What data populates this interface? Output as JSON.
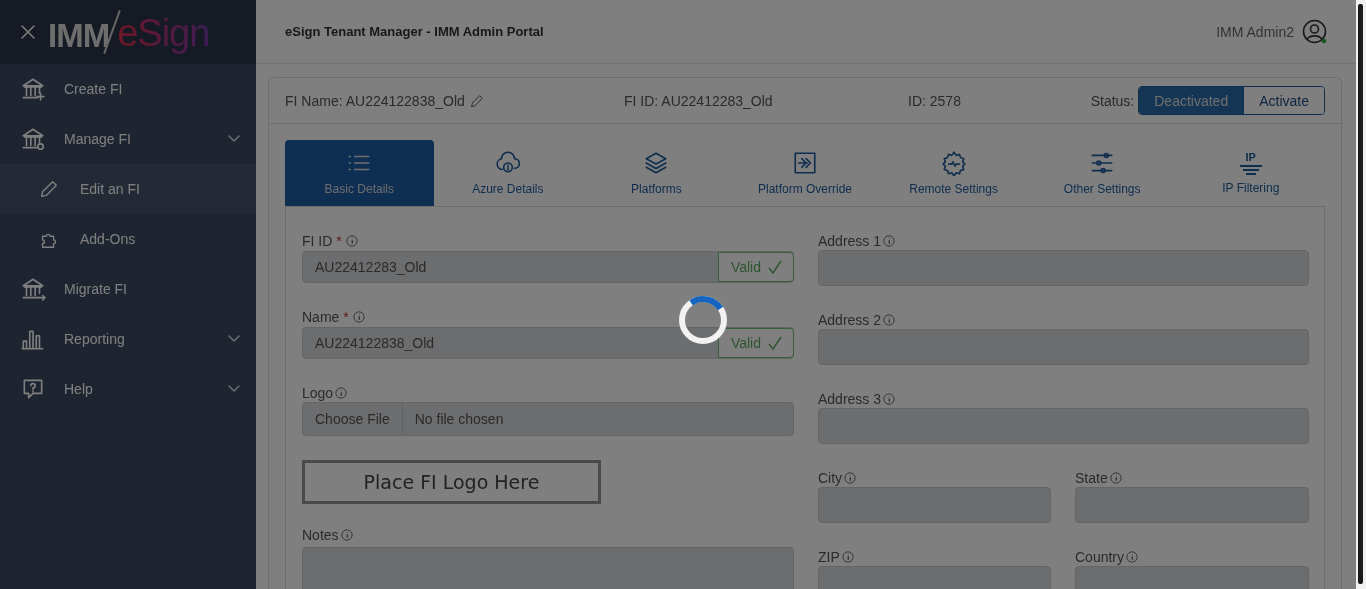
{
  "sidebar": {
    "logo": {
      "part_1": "IMM",
      "part_2": "eSign"
    },
    "items": [
      {
        "label": "Create FI",
        "kind": "link"
      },
      {
        "label": "Manage FI",
        "kind": "group",
        "expanded": true,
        "children": [
          {
            "label": "Edit an FI",
            "selected": true
          },
          {
            "label": "Add-Ons",
            "selected": false
          }
        ]
      },
      {
        "label": "Migrate FI",
        "kind": "link"
      },
      {
        "label": "Reporting",
        "kind": "group",
        "expanded": false
      },
      {
        "label": "Help",
        "kind": "group",
        "expanded": false
      }
    ]
  },
  "header": {
    "title": "eSign Tenant Manager - IMM Admin Portal",
    "user_name": "IMM Admin2"
  },
  "fi_bar": {
    "fi_name": "FI Name: AU224122838_Old",
    "fi_id": "FI ID: AU22412283_Old",
    "id": "ID: 2578",
    "status_label": "Status:",
    "status_options": [
      {
        "label": "Deactivated",
        "selected": true
      },
      {
        "label": "Activate",
        "selected": false
      }
    ]
  },
  "tabs": [
    {
      "label": "Basic Details",
      "selected": true
    },
    {
      "label": "Azure Details",
      "selected": false
    },
    {
      "label": "Platforms",
      "selected": false
    },
    {
      "label": "Platform Override",
      "selected": false
    },
    {
      "label": "Remote Settings",
      "selected": false
    },
    {
      "label": "Other Settings",
      "selected": false
    },
    {
      "label": "IP Filtering",
      "selected": false,
      "icon_label": "IP"
    }
  ],
  "form": {
    "left": [
      {
        "kind": "text",
        "label": "FI ID",
        "required_mark": "*",
        "value": "AU22412283_Old",
        "validation": "Valid"
      },
      {
        "kind": "text",
        "label": "Name",
        "required_mark": "*",
        "value": "AU224122838_Old",
        "validation": "Valid"
      },
      {
        "kind": "file",
        "label": "Logo",
        "button": "Choose File",
        "value": "No file chosen"
      },
      {
        "kind": "logo",
        "text": "Place FI Logo Here"
      },
      {
        "kind": "textarea",
        "label": "Notes"
      }
    ],
    "right": [
      [
        {
          "label": "Address 1"
        }
      ],
      [
        {
          "label": "Address 2"
        }
      ],
      [
        {
          "label": "Address 3"
        }
      ],
      [
        {
          "label": "City"
        },
        {
          "label": "State"
        }
      ],
      [
        {
          "label": "ZIP"
        },
        {
          "label": "Country"
        }
      ]
    ]
  },
  "loading": true
}
